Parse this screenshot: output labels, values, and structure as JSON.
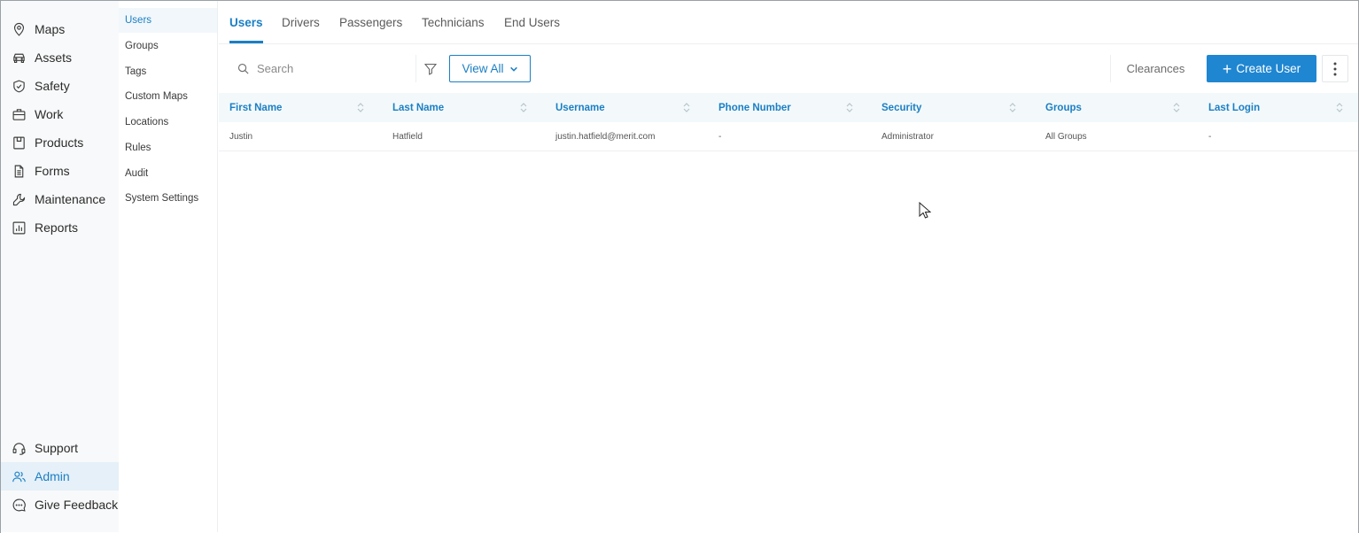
{
  "nav": {
    "top_items": [
      {
        "label": "Maps",
        "icon": "map-pin-icon"
      },
      {
        "label": "Assets",
        "icon": "car-icon"
      },
      {
        "label": "Safety",
        "icon": "shield-icon"
      },
      {
        "label": "Work",
        "icon": "briefcase-icon"
      },
      {
        "label": "Products",
        "icon": "box-icon"
      },
      {
        "label": "Forms",
        "icon": "document-icon"
      },
      {
        "label": "Maintenance",
        "icon": "wrench-icon"
      },
      {
        "label": "Reports",
        "icon": "bar-chart-icon"
      }
    ],
    "bottom_items": [
      {
        "label": "Support",
        "icon": "headset-icon"
      },
      {
        "label": "Admin",
        "icon": "users-icon",
        "active": true
      },
      {
        "label": "Give Feedback",
        "icon": "chat-icon"
      }
    ]
  },
  "subnav": {
    "items": [
      "Users",
      "Groups",
      "Tags",
      "Custom Maps",
      "Locations",
      "Rules",
      "Audit",
      "System Settings"
    ],
    "active": "Users"
  },
  "tabs": {
    "items": [
      "Users",
      "Drivers",
      "Passengers",
      "Technicians",
      "End Users"
    ],
    "active": "Users"
  },
  "toolbar": {
    "search_placeholder": "Search",
    "view_all_label": "View All",
    "clearances_label": "Clearances",
    "create_user_label": "Create User"
  },
  "table": {
    "columns": [
      "First Name",
      "Last Name",
      "Username",
      "Phone Number",
      "Security",
      "Groups",
      "Last Login"
    ],
    "rows": [
      [
        "Justin",
        "Hatfield",
        "justin.hatfield@merit.com",
        "-",
        "Administrator",
        "All Groups",
        "-"
      ]
    ]
  },
  "colors": {
    "accent": "#1b7fc4",
    "primary_button": "#1f86d1",
    "nav_bg": "#f8f9fa",
    "header_bg": "#f3f9fb"
  }
}
